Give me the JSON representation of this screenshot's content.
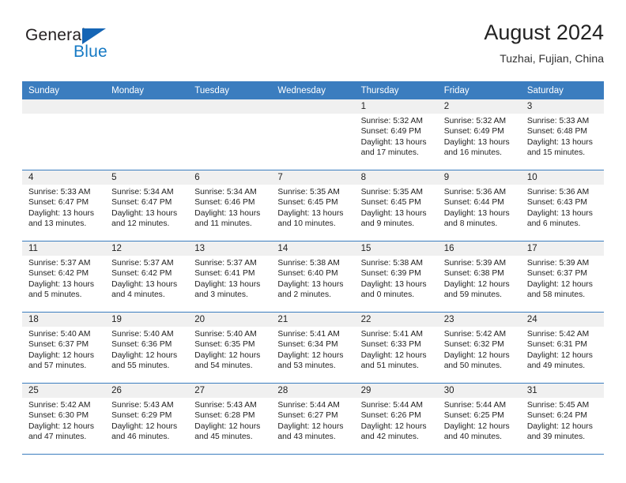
{
  "logo": {
    "word_top": "General",
    "word_bottom": "Blue",
    "triangle_icon": "triangle-icon",
    "color_blue": "#1579c4",
    "color_dark": "#231f20"
  },
  "header": {
    "title": "August 2024",
    "subtitle": "Tuzhai, Fujian, China"
  },
  "theme": {
    "header_row_bg": "#3b7dbf",
    "daynum_band_bg": "#f0f0f0",
    "row_divider": "#3b7dbf"
  },
  "weekdays": [
    "Sunday",
    "Monday",
    "Tuesday",
    "Wednesday",
    "Thursday",
    "Friday",
    "Saturday"
  ],
  "weeks": [
    [
      {
        "day": "",
        "sunrise": "",
        "sunset": "",
        "daylight_line1": "",
        "daylight_line2": "",
        "empty": true
      },
      {
        "day": "",
        "sunrise": "",
        "sunset": "",
        "daylight_line1": "",
        "daylight_line2": "",
        "empty": true
      },
      {
        "day": "",
        "sunrise": "",
        "sunset": "",
        "daylight_line1": "",
        "daylight_line2": "",
        "empty": true
      },
      {
        "day": "",
        "sunrise": "",
        "sunset": "",
        "daylight_line1": "",
        "daylight_line2": "",
        "empty": true
      },
      {
        "day": "1",
        "sunrise": "Sunrise: 5:32 AM",
        "sunset": "Sunset: 6:49 PM",
        "daylight_line1": "Daylight: 13 hours",
        "daylight_line2": "and 17 minutes.",
        "empty": false
      },
      {
        "day": "2",
        "sunrise": "Sunrise: 5:32 AM",
        "sunset": "Sunset: 6:49 PM",
        "daylight_line1": "Daylight: 13 hours",
        "daylight_line2": "and 16 minutes.",
        "empty": false
      },
      {
        "day": "3",
        "sunrise": "Sunrise: 5:33 AM",
        "sunset": "Sunset: 6:48 PM",
        "daylight_line1": "Daylight: 13 hours",
        "daylight_line2": "and 15 minutes.",
        "empty": false
      }
    ],
    [
      {
        "day": "4",
        "sunrise": "Sunrise: 5:33 AM",
        "sunset": "Sunset: 6:47 PM",
        "daylight_line1": "Daylight: 13 hours",
        "daylight_line2": "and 13 minutes.",
        "empty": false
      },
      {
        "day": "5",
        "sunrise": "Sunrise: 5:34 AM",
        "sunset": "Sunset: 6:47 PM",
        "daylight_line1": "Daylight: 13 hours",
        "daylight_line2": "and 12 minutes.",
        "empty": false
      },
      {
        "day": "6",
        "sunrise": "Sunrise: 5:34 AM",
        "sunset": "Sunset: 6:46 PM",
        "daylight_line1": "Daylight: 13 hours",
        "daylight_line2": "and 11 minutes.",
        "empty": false
      },
      {
        "day": "7",
        "sunrise": "Sunrise: 5:35 AM",
        "sunset": "Sunset: 6:45 PM",
        "daylight_line1": "Daylight: 13 hours",
        "daylight_line2": "and 10 minutes.",
        "empty": false
      },
      {
        "day": "8",
        "sunrise": "Sunrise: 5:35 AM",
        "sunset": "Sunset: 6:45 PM",
        "daylight_line1": "Daylight: 13 hours",
        "daylight_line2": "and 9 minutes.",
        "empty": false
      },
      {
        "day": "9",
        "sunrise": "Sunrise: 5:36 AM",
        "sunset": "Sunset: 6:44 PM",
        "daylight_line1": "Daylight: 13 hours",
        "daylight_line2": "and 8 minutes.",
        "empty": false
      },
      {
        "day": "10",
        "sunrise": "Sunrise: 5:36 AM",
        "sunset": "Sunset: 6:43 PM",
        "daylight_line1": "Daylight: 13 hours",
        "daylight_line2": "and 6 minutes.",
        "empty": false
      }
    ],
    [
      {
        "day": "11",
        "sunrise": "Sunrise: 5:37 AM",
        "sunset": "Sunset: 6:42 PM",
        "daylight_line1": "Daylight: 13 hours",
        "daylight_line2": "and 5 minutes.",
        "empty": false
      },
      {
        "day": "12",
        "sunrise": "Sunrise: 5:37 AM",
        "sunset": "Sunset: 6:42 PM",
        "daylight_line1": "Daylight: 13 hours",
        "daylight_line2": "and 4 minutes.",
        "empty": false
      },
      {
        "day": "13",
        "sunrise": "Sunrise: 5:37 AM",
        "sunset": "Sunset: 6:41 PM",
        "daylight_line1": "Daylight: 13 hours",
        "daylight_line2": "and 3 minutes.",
        "empty": false
      },
      {
        "day": "14",
        "sunrise": "Sunrise: 5:38 AM",
        "sunset": "Sunset: 6:40 PM",
        "daylight_line1": "Daylight: 13 hours",
        "daylight_line2": "and 2 minutes.",
        "empty": false
      },
      {
        "day": "15",
        "sunrise": "Sunrise: 5:38 AM",
        "sunset": "Sunset: 6:39 PM",
        "daylight_line1": "Daylight: 13 hours",
        "daylight_line2": "and 0 minutes.",
        "empty": false
      },
      {
        "day": "16",
        "sunrise": "Sunrise: 5:39 AM",
        "sunset": "Sunset: 6:38 PM",
        "daylight_line1": "Daylight: 12 hours",
        "daylight_line2": "and 59 minutes.",
        "empty": false
      },
      {
        "day": "17",
        "sunrise": "Sunrise: 5:39 AM",
        "sunset": "Sunset: 6:37 PM",
        "daylight_line1": "Daylight: 12 hours",
        "daylight_line2": "and 58 minutes.",
        "empty": false
      }
    ],
    [
      {
        "day": "18",
        "sunrise": "Sunrise: 5:40 AM",
        "sunset": "Sunset: 6:37 PM",
        "daylight_line1": "Daylight: 12 hours",
        "daylight_line2": "and 57 minutes.",
        "empty": false
      },
      {
        "day": "19",
        "sunrise": "Sunrise: 5:40 AM",
        "sunset": "Sunset: 6:36 PM",
        "daylight_line1": "Daylight: 12 hours",
        "daylight_line2": "and 55 minutes.",
        "empty": false
      },
      {
        "day": "20",
        "sunrise": "Sunrise: 5:40 AM",
        "sunset": "Sunset: 6:35 PM",
        "daylight_line1": "Daylight: 12 hours",
        "daylight_line2": "and 54 minutes.",
        "empty": false
      },
      {
        "day": "21",
        "sunrise": "Sunrise: 5:41 AM",
        "sunset": "Sunset: 6:34 PM",
        "daylight_line1": "Daylight: 12 hours",
        "daylight_line2": "and 53 minutes.",
        "empty": false
      },
      {
        "day": "22",
        "sunrise": "Sunrise: 5:41 AM",
        "sunset": "Sunset: 6:33 PM",
        "daylight_line1": "Daylight: 12 hours",
        "daylight_line2": "and 51 minutes.",
        "empty": false
      },
      {
        "day": "23",
        "sunrise": "Sunrise: 5:42 AM",
        "sunset": "Sunset: 6:32 PM",
        "daylight_line1": "Daylight: 12 hours",
        "daylight_line2": "and 50 minutes.",
        "empty": false
      },
      {
        "day": "24",
        "sunrise": "Sunrise: 5:42 AM",
        "sunset": "Sunset: 6:31 PM",
        "daylight_line1": "Daylight: 12 hours",
        "daylight_line2": "and 49 minutes.",
        "empty": false
      }
    ],
    [
      {
        "day": "25",
        "sunrise": "Sunrise: 5:42 AM",
        "sunset": "Sunset: 6:30 PM",
        "daylight_line1": "Daylight: 12 hours",
        "daylight_line2": "and 47 minutes.",
        "empty": false
      },
      {
        "day": "26",
        "sunrise": "Sunrise: 5:43 AM",
        "sunset": "Sunset: 6:29 PM",
        "daylight_line1": "Daylight: 12 hours",
        "daylight_line2": "and 46 minutes.",
        "empty": false
      },
      {
        "day": "27",
        "sunrise": "Sunrise: 5:43 AM",
        "sunset": "Sunset: 6:28 PM",
        "daylight_line1": "Daylight: 12 hours",
        "daylight_line2": "and 45 minutes.",
        "empty": false
      },
      {
        "day": "28",
        "sunrise": "Sunrise: 5:44 AM",
        "sunset": "Sunset: 6:27 PM",
        "daylight_line1": "Daylight: 12 hours",
        "daylight_line2": "and 43 minutes.",
        "empty": false
      },
      {
        "day": "29",
        "sunrise": "Sunrise: 5:44 AM",
        "sunset": "Sunset: 6:26 PM",
        "daylight_line1": "Daylight: 12 hours",
        "daylight_line2": "and 42 minutes.",
        "empty": false
      },
      {
        "day": "30",
        "sunrise": "Sunrise: 5:44 AM",
        "sunset": "Sunset: 6:25 PM",
        "daylight_line1": "Daylight: 12 hours",
        "daylight_line2": "and 40 minutes.",
        "empty": false
      },
      {
        "day": "31",
        "sunrise": "Sunrise: 5:45 AM",
        "sunset": "Sunset: 6:24 PM",
        "daylight_line1": "Daylight: 12 hours",
        "daylight_line2": "and 39 minutes.",
        "empty": false
      }
    ]
  ]
}
